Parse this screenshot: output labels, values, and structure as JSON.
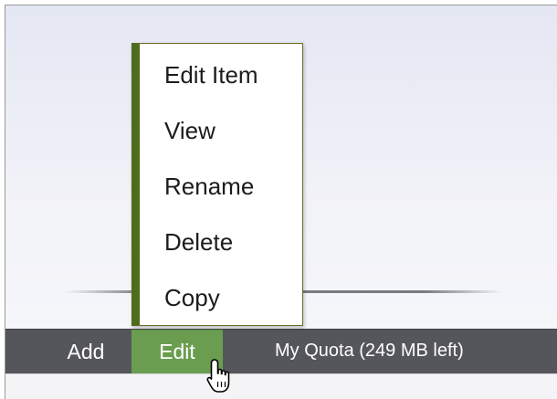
{
  "menu": {
    "items": [
      {
        "label": "Edit Item"
      },
      {
        "label": "View"
      },
      {
        "label": "Rename"
      },
      {
        "label": "Delete"
      },
      {
        "label": "Copy"
      }
    ]
  },
  "toolbar": {
    "add_label": "Add",
    "edit_label": "Edit",
    "quota_text": "My Quota (249 MB left)"
  },
  "colors": {
    "toolbar_bg": "#55565b",
    "edit_active_bg": "#6a9d50",
    "menu_accent": "#4f6b1c"
  },
  "icons": {
    "cursor": "hand-pointer-icon"
  }
}
